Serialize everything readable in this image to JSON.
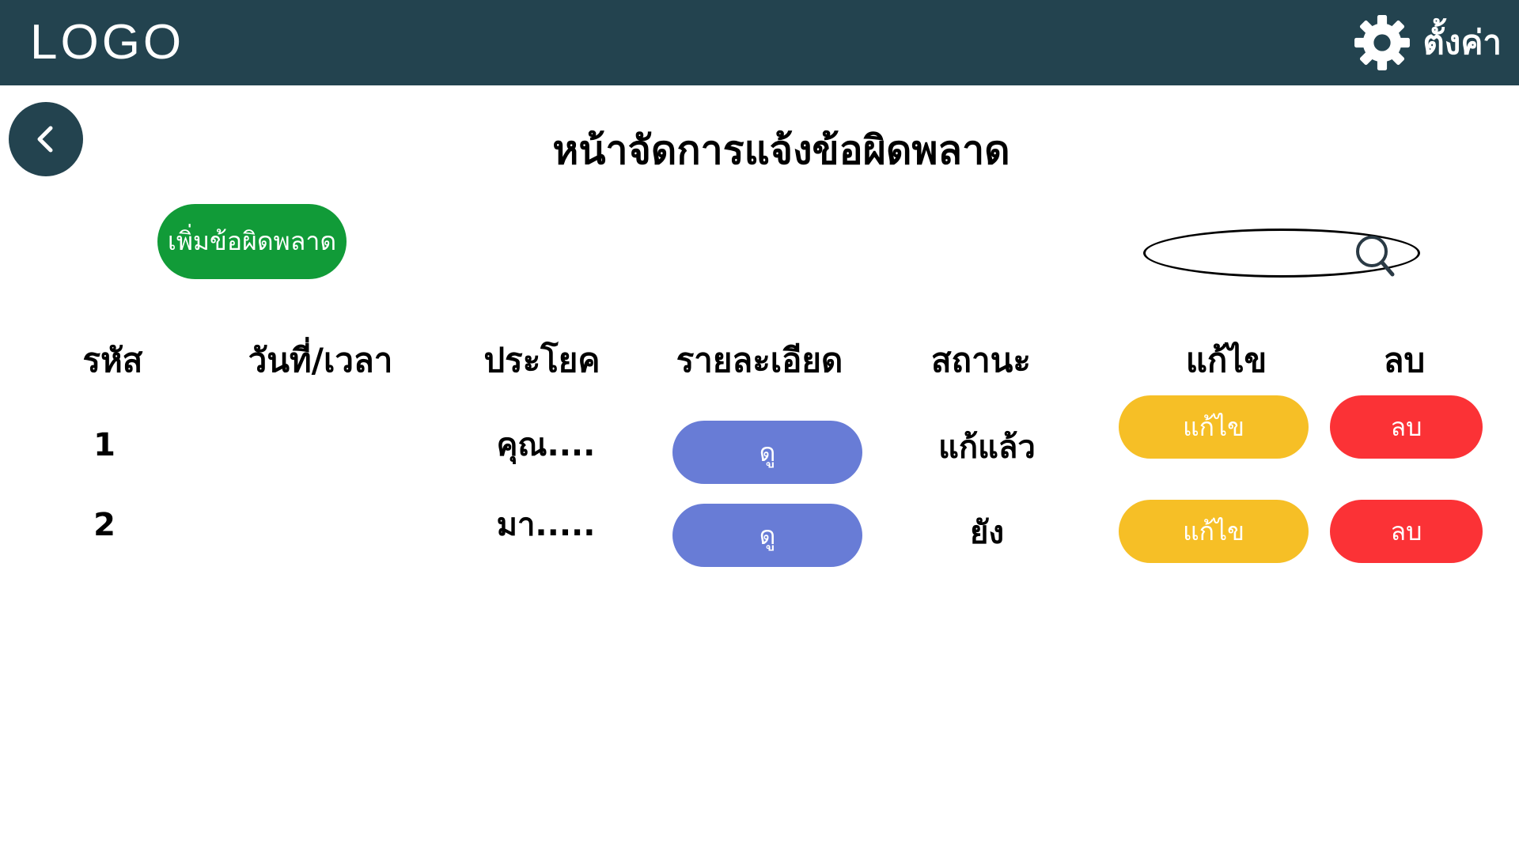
{
  "header": {
    "logo": "LOGO",
    "settings_label": "ตั้งค่า",
    "settings_icon": "gear-icon",
    "background_color": "#23434f"
  },
  "back_button": {
    "icon": "chevron-left-icon"
  },
  "page_title": "หน้าจัดการแจ้งข้อผิดพลาด",
  "add_button_label": "เพิ่มข้อผิดพลาด",
  "search": {
    "placeholder": "",
    "value": "",
    "icon": "search-icon"
  },
  "table": {
    "columns": [
      "รหัส",
      "วันที่/เวลา",
      "ประโยค",
      "รายละเอียด",
      "สถานะ",
      "แก้ไข",
      "ลบ"
    ],
    "rows": [
      {
        "id": "1",
        "datetime": "",
        "sentence": "คุณ....",
        "detail_button": "ดู",
        "status": "แก้แล้ว",
        "edit_button": "แก้ไข",
        "delete_button": "ลบ"
      },
      {
        "id": "2",
        "datetime": "",
        "sentence": "มา.....",
        "detail_button": "ดู",
        "status": "ยัง",
        "edit_button": "แก้ไข",
        "delete_button": "ลบ"
      }
    ]
  },
  "colors": {
    "add_button": "#119b38",
    "view_button": "#687cd6",
    "edit_button": "#f6bf26",
    "delete_button": "#fb3236"
  }
}
